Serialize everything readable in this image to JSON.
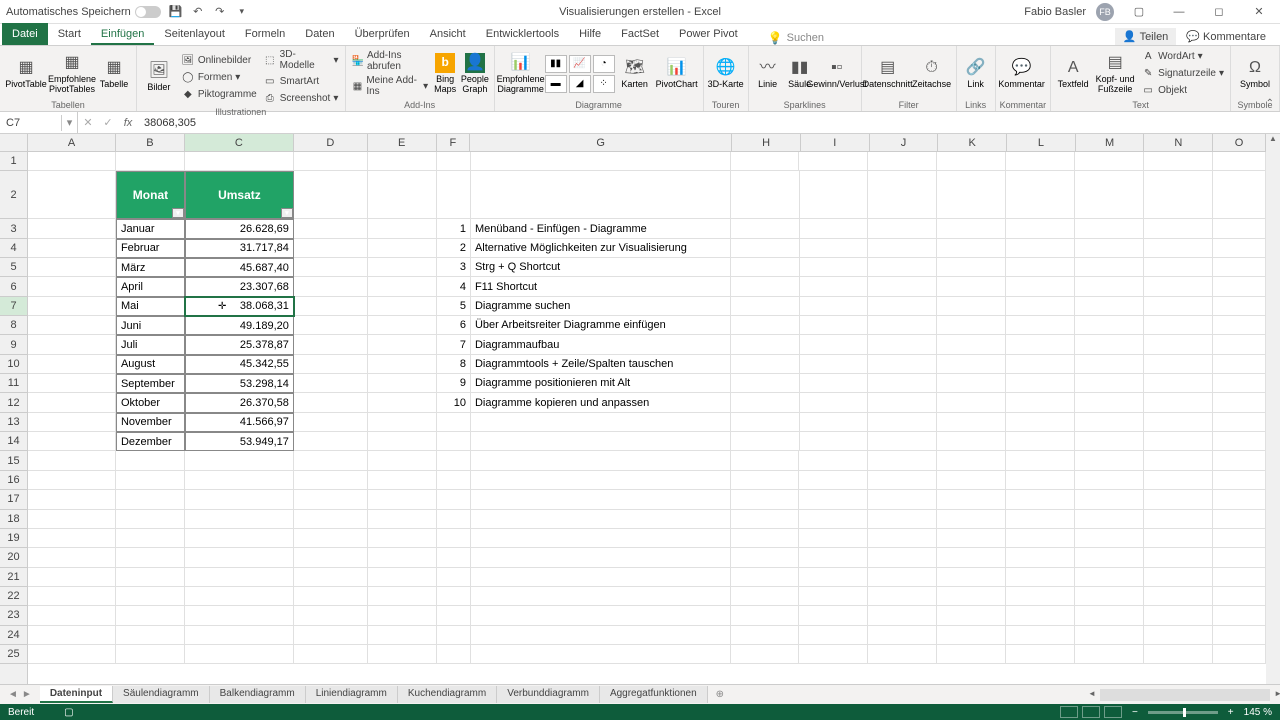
{
  "title": "Visualisierungen erstellen - Excel",
  "autosave_label": "Automatisches Speichern",
  "user_name": "Fabio Basler",
  "user_initials": "FB",
  "tabs": {
    "file": "Datei",
    "list": [
      "Start",
      "Einfügen",
      "Seitenlayout",
      "Formeln",
      "Daten",
      "Überprüfen",
      "Ansicht",
      "Entwicklertools",
      "Hilfe",
      "FactSet",
      "Power Pivot"
    ],
    "active": "Einfügen",
    "tell_me": "Suchen",
    "share": "Teilen",
    "comments": "Kommentare"
  },
  "ribbon": {
    "groups": {
      "tables": {
        "label": "Tabellen",
        "pivot": "PivotTable",
        "recpivot": "Empfohlene PivotTables",
        "table": "Tabelle"
      },
      "illus": {
        "label": "Illustrationen",
        "pics": "Bilder",
        "online": "Onlinebilder",
        "shapes": "Formen",
        "pikto": "Piktogramme",
        "models": "3D-Modelle",
        "smart": "SmartArt",
        "screenshot": "Screenshot"
      },
      "addins": {
        "label": "Add-Ins",
        "get": "Add-Ins abrufen",
        "my": "Meine Add-Ins",
        "bing": "Bing Maps",
        "people": "People Graph"
      },
      "charts": {
        "label": "Diagramme",
        "rec": "Empfohlene Diagramme",
        "maps": "Karten",
        "pivotchart": "PivotChart"
      },
      "tours": {
        "label": "Touren",
        "map3d": "3D-Karte"
      },
      "spark": {
        "label": "Sparklines",
        "line": "Linie",
        "col": "Säule",
        "winloss": "Gewinn/Verlust"
      },
      "filter": {
        "label": "Filter",
        "slicer": "Datenschnitt",
        "timeline": "Zeitachse"
      },
      "links": {
        "label": "Links",
        "link": "Link"
      },
      "comment": {
        "label": "Kommentar",
        "comment": "Kommentar"
      },
      "text": {
        "label": "Text",
        "textbox": "Textfeld",
        "header": "Kopf- und Fußzeile",
        "wordart": "WordArt",
        "sig": "Signaturzeile",
        "obj": "Objekt"
      },
      "symbols": {
        "label": "Symbole",
        "symbol": "Symbol"
      }
    }
  },
  "namebox": "C7",
  "formula": "38068,305",
  "columns": [
    "A",
    "B",
    "C",
    "D",
    "E",
    "F",
    "G",
    "H",
    "I",
    "J",
    "K",
    "L",
    "M",
    "N",
    "O"
  ],
  "table_headers": {
    "month": "Monat",
    "sales": "Umsatz"
  },
  "data": [
    {
      "m": "Januar",
      "v": "26.628,69"
    },
    {
      "m": "Februar",
      "v": "31.717,84"
    },
    {
      "m": "März",
      "v": "45.687,40"
    },
    {
      "m": "April",
      "v": "23.307,68"
    },
    {
      "m": "Mai",
      "v": "38.068,31"
    },
    {
      "m": "Juni",
      "v": "49.189,20"
    },
    {
      "m": "Juli",
      "v": "25.378,87"
    },
    {
      "m": "August",
      "v": "45.342,55"
    },
    {
      "m": "September",
      "v": "53.298,14"
    },
    {
      "m": "Oktober",
      "v": "26.370,58"
    },
    {
      "m": "November",
      "v": "41.566,97"
    },
    {
      "m": "Dezember",
      "v": "53.949,17"
    }
  ],
  "notes": [
    {
      "n": "1",
      "t": "Menüband - Einfügen - Diagramme"
    },
    {
      "n": "2",
      "t": "Alternative Möglichkeiten zur Visualisierung"
    },
    {
      "n": "3",
      "t": "Strg + Q Shortcut"
    },
    {
      "n": "4",
      "t": "F11 Shortcut"
    },
    {
      "n": "5",
      "t": "Diagramme suchen"
    },
    {
      "n": "6",
      "t": "Über Arbeitsreiter Diagramme einfügen"
    },
    {
      "n": "7",
      "t": "Diagrammaufbau"
    },
    {
      "n": "8",
      "t": "Diagrammtools + Zeile/Spalten tauschen"
    },
    {
      "n": "9",
      "t": "Diagramme positionieren mit Alt"
    },
    {
      "n": "10",
      "t": "Diagramme kopieren und anpassen"
    }
  ],
  "sheets": [
    "Dateninput",
    "Säulendiagramm",
    "Balkendiagramm",
    "Liniendiagramm",
    "Kuchendiagramm",
    "Verbunddiagramm",
    "Aggregatfunktionen"
  ],
  "active_sheet": "Dateninput",
  "status": "Bereit",
  "zoom": "145 %"
}
